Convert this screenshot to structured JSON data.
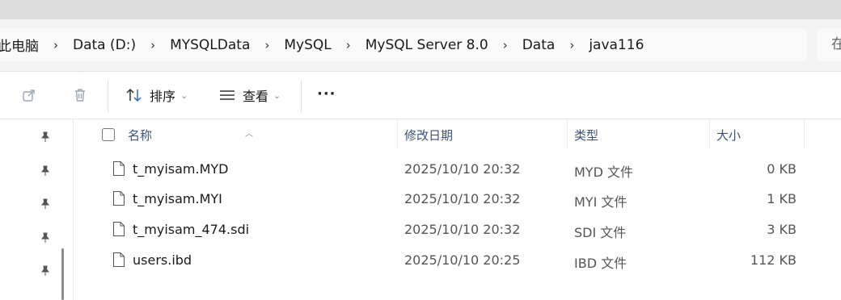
{
  "breadcrumb": {
    "items": [
      "此电脑",
      "Data (D:)",
      "MYSQLData",
      "MySQL",
      "MySQL Server 8.0",
      "Data",
      "java116"
    ],
    "separator": "›"
  },
  "search": {
    "visible_text": "在"
  },
  "toolbar": {
    "sort_label": "排序",
    "view_label": "查看",
    "more_label": "···"
  },
  "columns": {
    "name": "名称",
    "date": "修改日期",
    "type": "类型",
    "size": "大小"
  },
  "files": [
    {
      "name": "t_myisam.MYD",
      "date": "2025/10/10 20:32",
      "type": "MYD 文件",
      "size": "0 KB"
    },
    {
      "name": "t_myisam.MYI",
      "date": "2025/10/10 20:32",
      "type": "MYI 文件",
      "size": "1 KB"
    },
    {
      "name": "t_myisam_474.sdi",
      "date": "2025/10/10 20:32",
      "type": "SDI 文件",
      "size": "3 KB"
    },
    {
      "name": "users.ibd",
      "date": "2025/10/10 20:25",
      "type": "IBD 文件",
      "size": "112 KB"
    }
  ],
  "icons": {
    "share": "share-icon",
    "delete": "trash-icon",
    "sort": "sort-icon",
    "view": "view-lines-icon",
    "pin": "pin-icon",
    "file": "file-icon"
  },
  "colors": {
    "header_text": "#3b5377",
    "address_bar_bg": "#f3f3f3",
    "toolbar_icon_disabled": "#9aa7b5"
  }
}
